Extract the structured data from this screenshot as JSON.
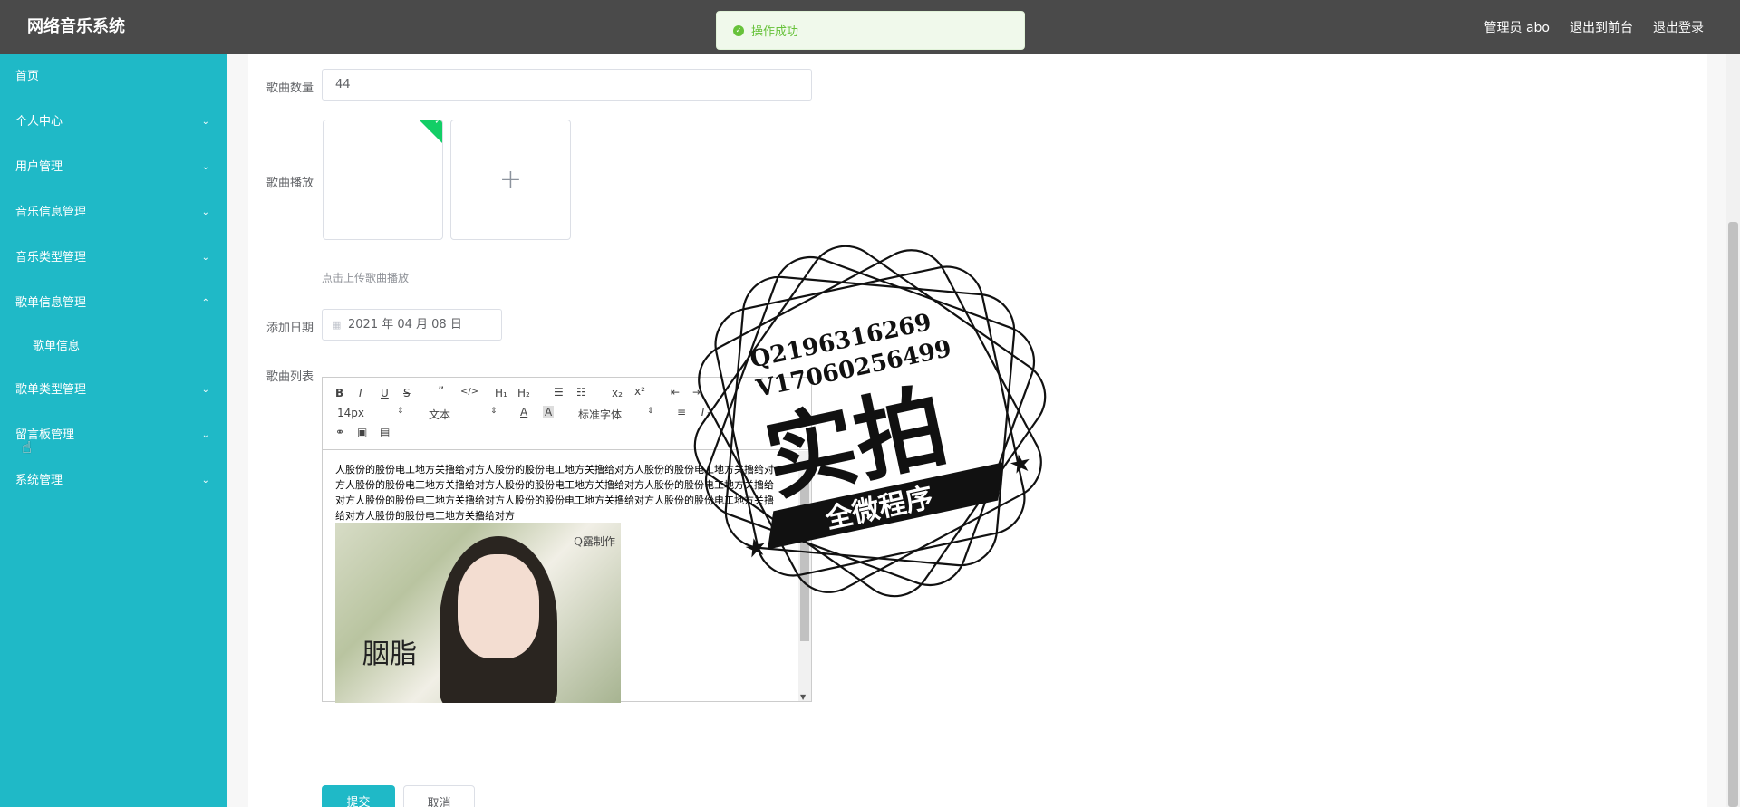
{
  "header": {
    "brand": "网络音乐系统",
    "user": "管理员 abo",
    "to_front": "退出到前台",
    "logout": "退出登录"
  },
  "toast": {
    "text": "操作成功"
  },
  "sidebar": {
    "items": [
      {
        "label": "首页",
        "chevron": ""
      },
      {
        "label": "个人中心",
        "chevron": "⌄"
      },
      {
        "label": "用户管理",
        "chevron": "⌄"
      },
      {
        "label": "音乐信息管理",
        "chevron": "⌄"
      },
      {
        "label": "音乐类型管理",
        "chevron": "⌄"
      },
      {
        "label": "歌单信息管理",
        "chevron": "⌃"
      },
      {
        "label": "歌单信息",
        "chevron": ""
      },
      {
        "label": "歌单类型管理",
        "chevron": "⌄"
      },
      {
        "label": "留言板管理",
        "chevron": "⌄"
      },
      {
        "label": "系统管理",
        "chevron": "⌄"
      }
    ]
  },
  "form": {
    "song_count_label": "歌曲数量",
    "song_count_value": "44",
    "song_play_label": "歌曲播放",
    "upload_tip": "点击上传歌曲播放",
    "add_date_label": "添加日期",
    "add_date_value": "2021 年 04 月 08 日",
    "song_list_label": "歌曲列表",
    "submit": "提交",
    "cancel": "取消"
  },
  "editor": {
    "font_size": "14px",
    "block_type": "文本",
    "font_family": "标准字体",
    "content": "人股份的股份电工地方关撸给对方人股份的股份电工地方关撸给对方人股份的股份电工地方关撸给对方人股份的股份电工地方关撸给对方人股份的股份电工地方关撸给对方人股份的股份电工地方关撸给对方人股份的股份电工地方关撸给对方人股份的股份电工地方关撸给对方人股份的股份电工地方关撸给对方人股份的股份电工地方关撸给对方",
    "image_caption": "胭脂",
    "image_mark": "Q露制作"
  },
  "watermark": {
    "line1": "Q2196316269",
    "line2": "V17060256499",
    "main": "实拍",
    "ribbon": "全微程序"
  }
}
